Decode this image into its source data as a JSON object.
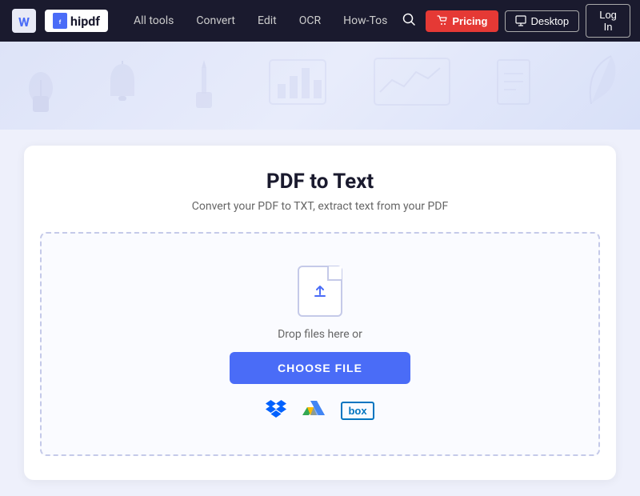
{
  "navbar": {
    "brand": "hipdf",
    "links": [
      {
        "label": "All tools",
        "id": "all-tools"
      },
      {
        "label": "Convert",
        "id": "convert"
      },
      {
        "label": "Edit",
        "id": "edit"
      },
      {
        "label": "OCR",
        "id": "ocr"
      },
      {
        "label": "How-Tos",
        "id": "how-tos"
      }
    ],
    "pricing_label": "Pricing",
    "desktop_label": "Desktop",
    "login_label": "Log In"
  },
  "hero": {
    "banner_icons": [
      "🌿",
      "🔔",
      "✏️",
      "📊",
      "📈",
      "📄",
      "✒️"
    ]
  },
  "main": {
    "title": "PDF to Text",
    "subtitle": "Convert your PDF to TXT, extract text from your PDF",
    "drop_text": "Drop files here or",
    "choose_file_label": "CHOOSE FILE"
  }
}
